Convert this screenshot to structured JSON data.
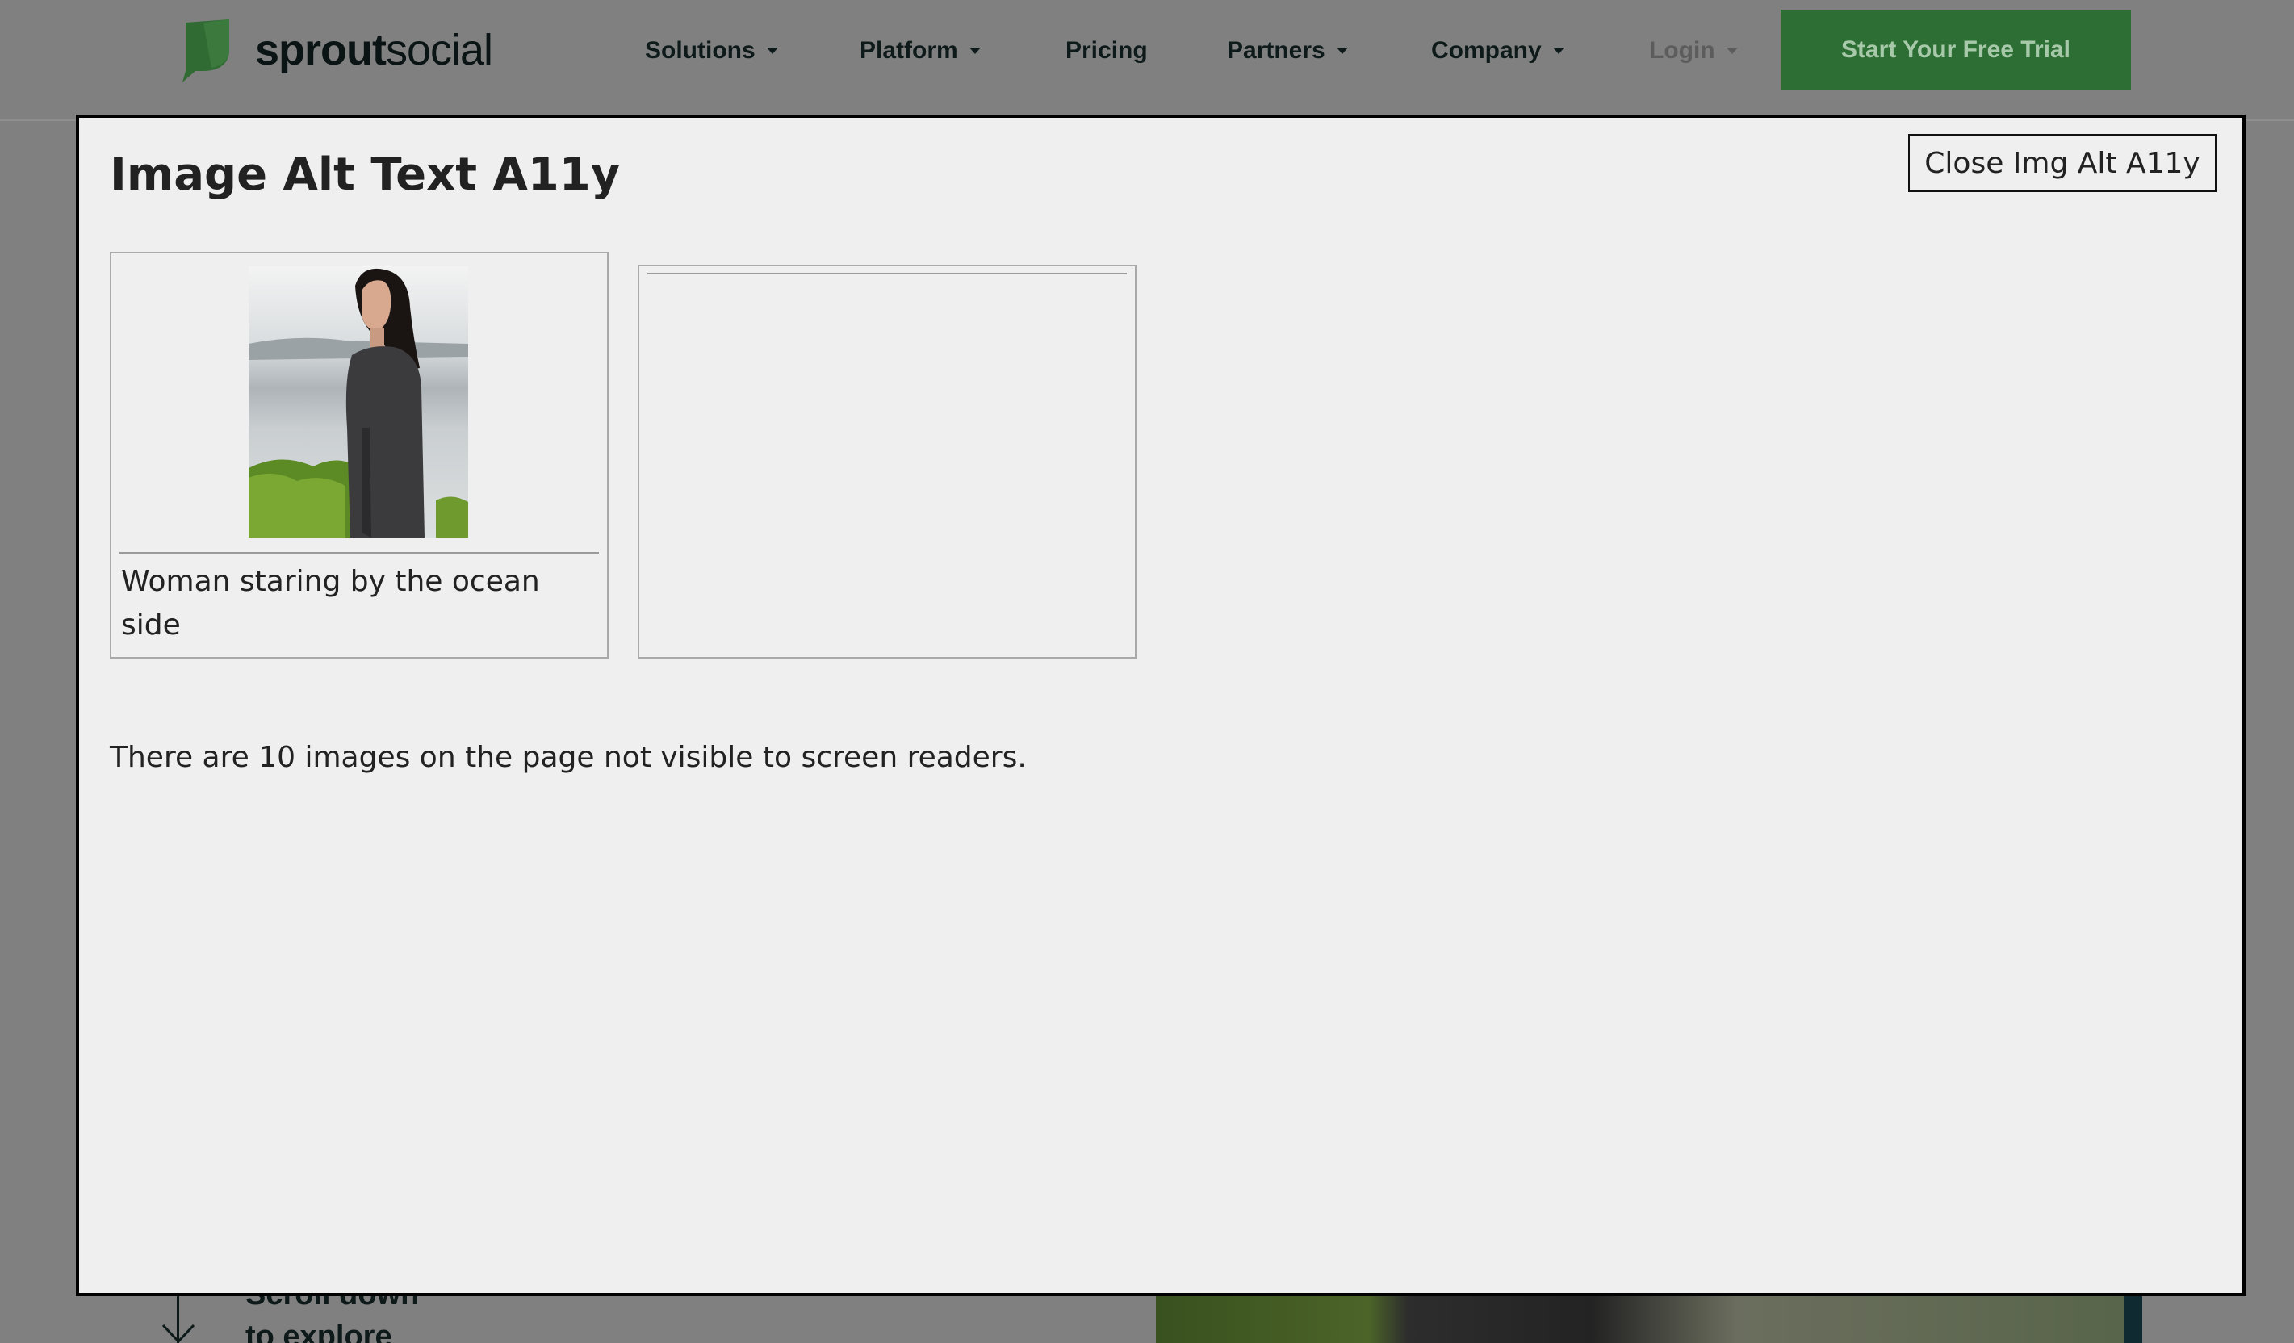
{
  "header": {
    "logo": {
      "bold": "sprout",
      "regular": "social"
    },
    "nav": [
      {
        "label": "Solutions",
        "dropdown": true
      },
      {
        "label": "Platform",
        "dropdown": true
      },
      {
        "label": "Pricing",
        "dropdown": false
      },
      {
        "label": "Partners",
        "dropdown": true
      },
      {
        "label": "Company",
        "dropdown": true
      },
      {
        "label": "Login",
        "dropdown": true
      }
    ],
    "cta_label": "Start Your Free Trial"
  },
  "background": {
    "scroll_hint_line1": "Scroll down",
    "scroll_hint_line2": "to explore"
  },
  "modal": {
    "title": "Image Alt Text A11y",
    "close_label": "Close Img Alt A11y",
    "images": [
      {
        "alt": "Woman staring by the ocean side"
      },
      {
        "alt": ""
      }
    ],
    "summary": "There are 10 images on the page not visible to screen readers."
  },
  "colors": {
    "overlay": "#808080",
    "brand_green": "#2d6e35",
    "modal_bg": "#efefef"
  }
}
